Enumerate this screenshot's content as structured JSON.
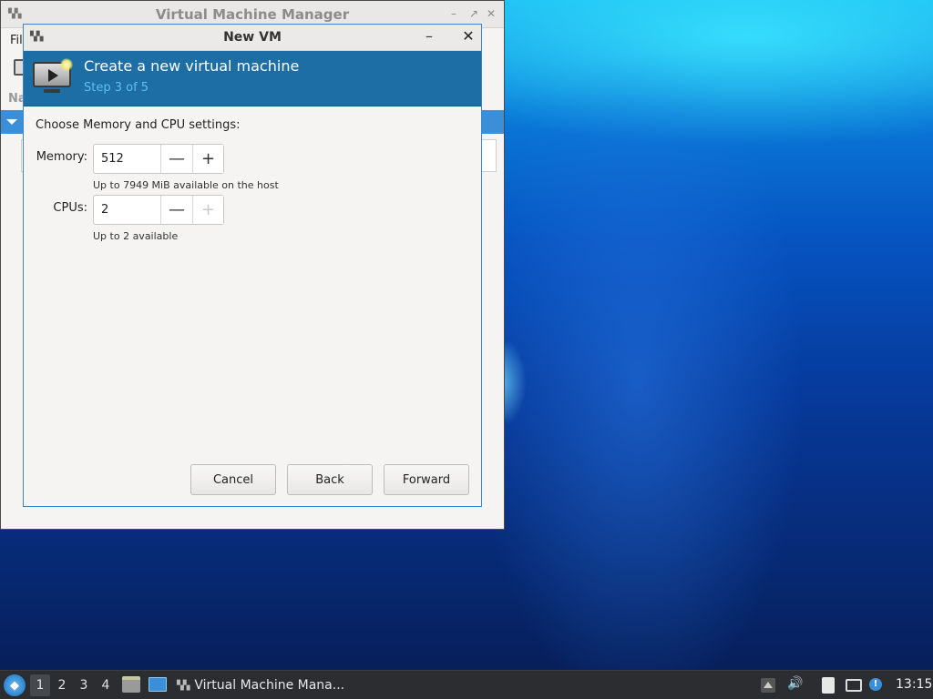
{
  "background_window": {
    "title": "Virtual Machine Manager",
    "menu_partial": "Fil",
    "column_header_partial": "Na"
  },
  "dialog": {
    "title": "New VM",
    "header": {
      "title": "Create a new virtual machine",
      "step": "Step 3 of 5"
    },
    "prompt": "Choose Memory and CPU settings:",
    "memory": {
      "label": "Memory:",
      "value": "512",
      "hint": "Up to 7949 MiB available on the host"
    },
    "cpus": {
      "label": "CPUs:",
      "value": "2",
      "hint": "Up to 2 available"
    },
    "buttons": {
      "cancel": "Cancel",
      "back": "Back",
      "forward": "Forward"
    },
    "controls": {
      "minimize": "–",
      "close": "✕",
      "decrement": "—",
      "increment": "+"
    }
  },
  "taskbar": {
    "workspaces": [
      "1",
      "2",
      "3",
      "4"
    ],
    "active_workspace": "1",
    "task_label": "Virtual Machine Mana...",
    "clock": "13:15"
  },
  "colors": {
    "header_bg": "#1c6ea4",
    "step_text": "#5fc0f0",
    "selection": "#3b8fd9",
    "taskbar_bg": "#2b2d30"
  }
}
